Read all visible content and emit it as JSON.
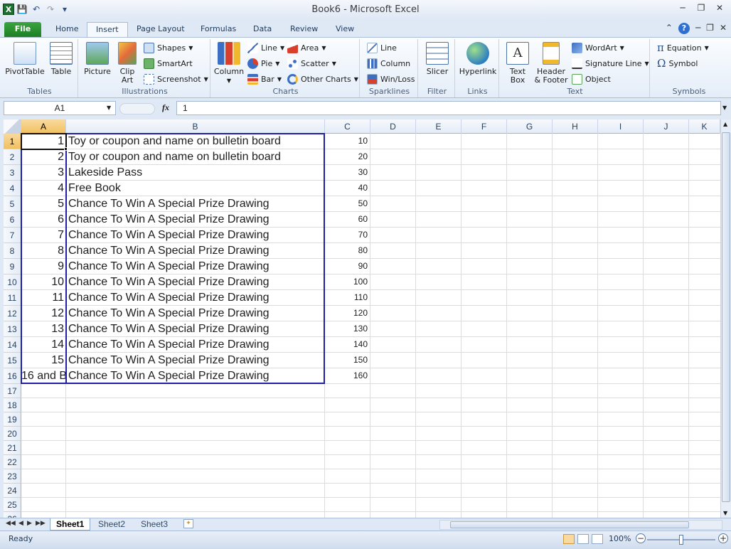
{
  "window": {
    "title": "Book6  -  Microsoft Excel"
  },
  "quick_access": [
    "excel-logo-icon",
    "save-icon",
    "undo-icon",
    "redo-icon",
    "customize-icon"
  ],
  "tabs": [
    {
      "label": "File"
    },
    {
      "label": "Home"
    },
    {
      "label": "Insert"
    },
    {
      "label": "Page Layout"
    },
    {
      "label": "Formulas"
    },
    {
      "label": "Data"
    },
    {
      "label": "Review"
    },
    {
      "label": "View"
    }
  ],
  "ribbon": {
    "groups": {
      "tables": "Tables",
      "illustrations": "Illustrations",
      "charts": "Charts",
      "sparklines": "Sparklines",
      "filter": "Filter",
      "links": "Links",
      "text": "Text",
      "symbols": "Symbols"
    },
    "pivottable": "PivotTable",
    "table": "Table",
    "picture": "Picture",
    "clip_art_1": "Clip",
    "clip_art_2": "Art",
    "shapes": "Shapes",
    "smartart": "SmartArt",
    "screenshot": "Screenshot",
    "column": "Column",
    "line": "Line",
    "pie": "Pie",
    "bar": "Bar",
    "area": "Area",
    "scatter": "Scatter",
    "other_charts": "Other Charts",
    "sp_line": "Line",
    "sp_column": "Column",
    "sp_winloss": "Win/Loss",
    "slicer": "Slicer",
    "hyperlink": "Hyperlink",
    "textbox_1": "Text",
    "textbox_2": "Box",
    "header_1": "Header",
    "header_2": "& Footer",
    "wordart": "WordArt",
    "signature_line": "Signature Line",
    "object": "Object",
    "equation": "Equation",
    "symbol": "Symbol"
  },
  "formula_bar": {
    "name_box": "A1",
    "fx": "fx",
    "formula": "1"
  },
  "columns": [
    "A",
    "B",
    "C",
    "D",
    "E",
    "F",
    "G",
    "H",
    "I",
    "J",
    "K"
  ],
  "row_numbers": [
    "1",
    "2",
    "3",
    "4",
    "5",
    "6",
    "7",
    "8",
    "9",
    "10",
    "11",
    "12",
    "13",
    "14",
    "15",
    "16",
    "17",
    "18",
    "19",
    "20",
    "21",
    "22",
    "23",
    "24",
    "25",
    "26"
  ],
  "rows": [
    {
      "a": "1",
      "b": "Toy or coupon and name on bulletin board",
      "c": "10"
    },
    {
      "a": "2",
      "b": "Toy or coupon and name on bulletin board",
      "c": "20"
    },
    {
      "a": "3",
      "b": "Lakeside Pass",
      "c": "30"
    },
    {
      "a": "4",
      "b": "Free Book",
      "c": "40"
    },
    {
      "a": "5",
      "b": "Chance To Win A Special Prize Drawing",
      "c": "50"
    },
    {
      "a": "6",
      "b": "Chance To Win A Special Prize Drawing",
      "c": "60"
    },
    {
      "a": "7",
      "b": "Chance To Win A Special Prize Drawing",
      "c": "70"
    },
    {
      "a": "8",
      "b": "Chance To Win A Special Prize Drawing",
      "c": "80"
    },
    {
      "a": "9",
      "b": "Chance To Win A Special Prize Drawing",
      "c": "90"
    },
    {
      "a": "10",
      "b": "Chance To Win A Special Prize Drawing",
      "c": "100"
    },
    {
      "a": "11",
      "b": "Chance To Win A Special Prize Drawing",
      "c": "110"
    },
    {
      "a": "12",
      "b": "Chance To Win A Special Prize Drawing",
      "c": "120"
    },
    {
      "a": "13",
      "b": "Chance To Win A Special Prize Drawing",
      "c": "130"
    },
    {
      "a": "14",
      "b": "Chance To Win A Special Prize Drawing",
      "c": "140"
    },
    {
      "a": "15",
      "b": "Chance To Win A Special Prize Drawing",
      "c": "150"
    },
    {
      "a": "16 and B",
      "b": "Chance To Win A Special Prize Drawing",
      "c": "160"
    }
  ],
  "sheets": [
    {
      "label": "Sheet1"
    },
    {
      "label": "Sheet2"
    },
    {
      "label": "Sheet3"
    }
  ],
  "status": {
    "text": "Ready",
    "zoom": "100%"
  },
  "colors": {
    "border_blue": "#1f1fa8",
    "header_selected": "#f1c15f",
    "file_tab": "#1e7e24"
  }
}
